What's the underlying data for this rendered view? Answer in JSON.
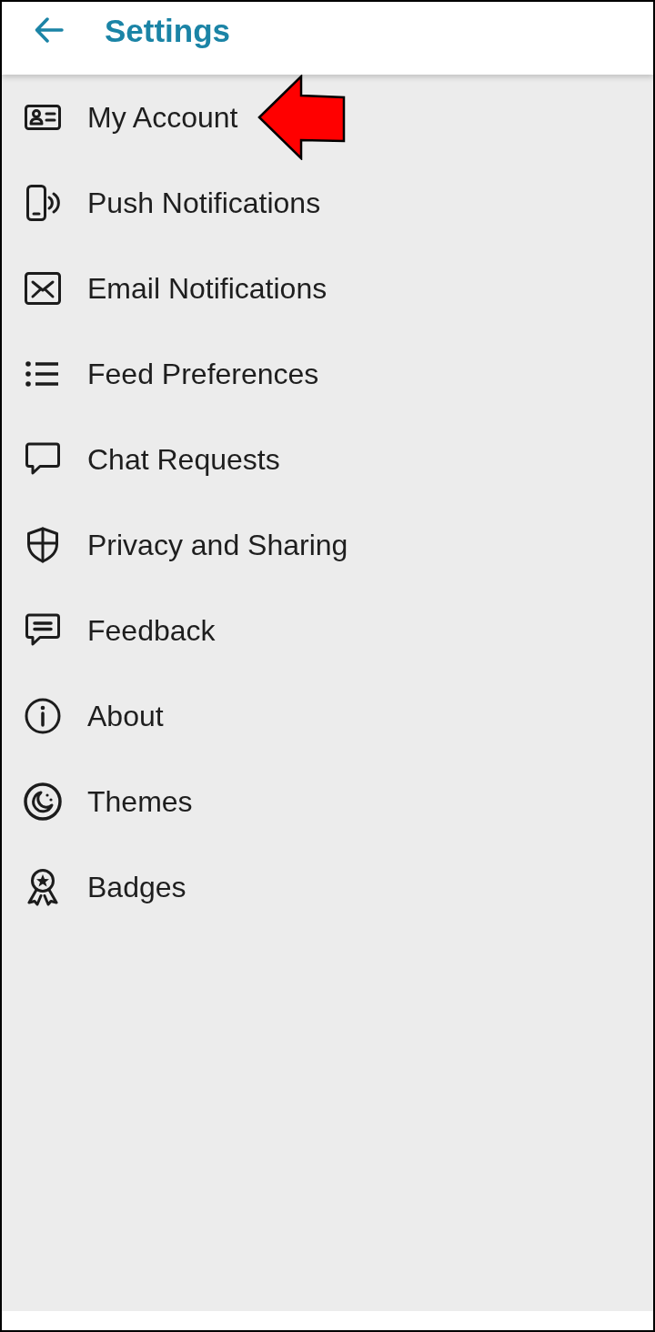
{
  "header": {
    "title": "Settings"
  },
  "items": [
    {
      "kind": "account",
      "label": "My Account",
      "pointed_at": true
    },
    {
      "kind": "push",
      "label": "Push Notifications",
      "pointed_at": false
    },
    {
      "kind": "email",
      "label": "Email Notifications",
      "pointed_at": false
    },
    {
      "kind": "feed",
      "label": "Feed Preferences",
      "pointed_at": false
    },
    {
      "kind": "chat",
      "label": "Chat Requests",
      "pointed_at": false
    },
    {
      "kind": "privacy",
      "label": "Privacy and Sharing",
      "pointed_at": false
    },
    {
      "kind": "feedback",
      "label": "Feedback",
      "pointed_at": false
    },
    {
      "kind": "about",
      "label": "About",
      "pointed_at": false
    },
    {
      "kind": "themes",
      "label": "Themes",
      "pointed_at": false
    },
    {
      "kind": "badges",
      "label": "Badges",
      "pointed_at": false
    }
  ]
}
